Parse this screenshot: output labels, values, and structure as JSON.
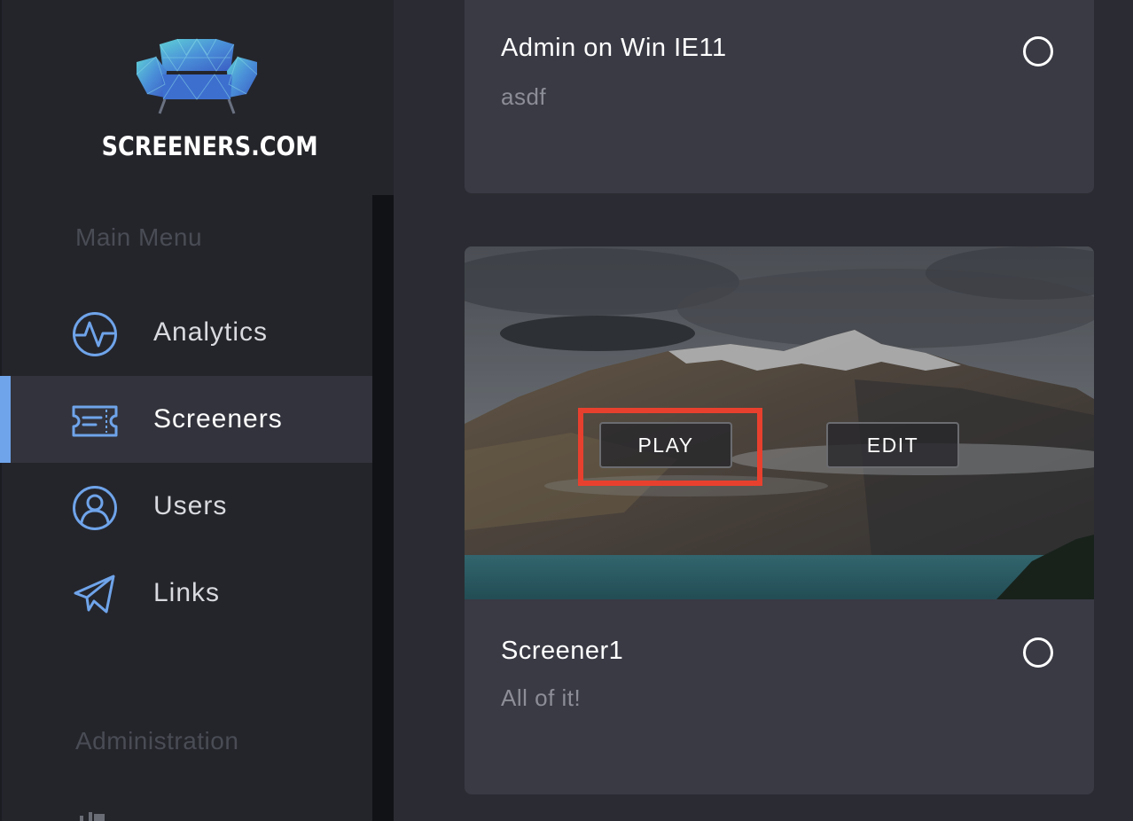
{
  "brand": {
    "name": "SCREENERS.COM"
  },
  "sidebar": {
    "main_menu_title": "Main Menu",
    "items": [
      {
        "label": "Analytics",
        "icon": "analytics-icon",
        "active": false
      },
      {
        "label": "Screeners",
        "icon": "ticket-icon",
        "active": true
      },
      {
        "label": "Users",
        "icon": "user-icon",
        "active": false
      },
      {
        "label": "Links",
        "icon": "paper-plane-icon",
        "active": false
      }
    ],
    "admin_title": "Administration"
  },
  "cards": [
    {
      "title": "Admin on Win IE11",
      "subtitle": "asdf",
      "selected": false
    },
    {
      "title": "Screener1",
      "subtitle": "All of it!",
      "selected": false,
      "actions": {
        "play_label": "PLAY",
        "edit_label": "EDIT"
      }
    }
  ],
  "colors": {
    "accent": "#6fa4ea",
    "highlight": "#e8402e",
    "sidebar_bg": "#24252b",
    "card_bg": "#393a44"
  }
}
